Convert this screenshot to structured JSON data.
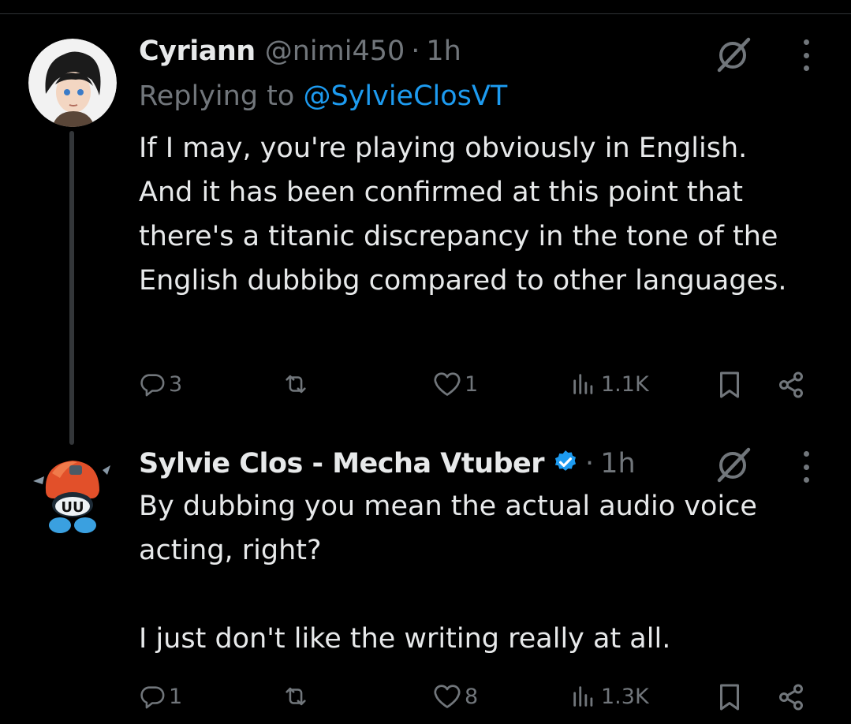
{
  "tweets": [
    {
      "name": "Cyriann",
      "handle": "@nimi450",
      "dot": "·",
      "time": "1h",
      "replying_prefix": "Replying to ",
      "replying_handle": "@SylvieClosVT",
      "text": "If I may, you're playing obviously in English.\nAnd it has been confirmed at this point that there's a titanic discrepancy in the tone of the English dubbibg compared to other languages.",
      "replies": "3",
      "retweets": "",
      "likes": "1",
      "views": "1.1K"
    },
    {
      "name": "Sylvie Clos - Mecha Vtuber",
      "dot": "·",
      "time": "1h",
      "verified": true,
      "text": "By dubbing you mean the actual audio voice acting, right?\n\nI just don't like the writing really at all.",
      "replies": "1",
      "retweets": "",
      "likes": "8",
      "views": "1.3K"
    }
  ],
  "icons": {
    "grok": "grok-icon",
    "more": "more-icon",
    "reply": "reply-icon",
    "retweet": "retweet-icon",
    "like": "heart-icon",
    "views": "views-icon",
    "bookmark": "bookmark-icon",
    "share": "share-icon"
  },
  "colors": {
    "background": "#000000",
    "text": "#e7e9ea",
    "muted": "#71767b",
    "link": "#1d9bf0",
    "verified": "#1d9bf0"
  }
}
